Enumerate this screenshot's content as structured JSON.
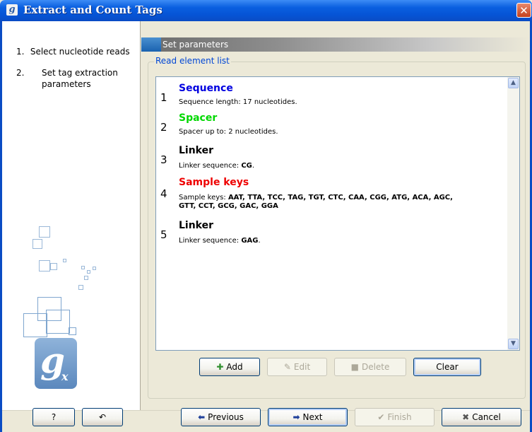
{
  "window": {
    "title": "Extract and Count Tags",
    "app_icon_letter": "g",
    "close_glyph": "✕"
  },
  "steps": [
    {
      "num": "1.",
      "label": "Select nucleotide reads"
    },
    {
      "num": "2.",
      "label": "Set tag extraction parameters"
    }
  ],
  "logo": {
    "g": "g",
    "x": "x"
  },
  "panel": {
    "header": "Set parameters",
    "group_label": "Read element list"
  },
  "elements": [
    {
      "num": "1",
      "name": "Sequence",
      "color": "#0000e0",
      "desc_prefix": "Sequence length: 17 nucleotides.",
      "desc_bold": "",
      "desc_suffix": ""
    },
    {
      "num": "2",
      "name": "Spacer",
      "color": "#00d800",
      "desc_prefix": "Spacer up to: 2 nucleotides.",
      "desc_bold": "",
      "desc_suffix": ""
    },
    {
      "num": "3",
      "name": "Linker",
      "color": "#000000",
      "desc_prefix": "Linker sequence: ",
      "desc_bold": "CG",
      "desc_suffix": "."
    },
    {
      "num": "4",
      "name": "Sample keys",
      "color": "#ee0000",
      "desc_prefix": "Sample keys: ",
      "desc_bold": "AAT, TTA, TCC, TAG, TGT, CTC, CAA, CGG, ATG, ACA, AGC, GTT, CCT, GCG, GAC, GGA",
      "desc_suffix": ""
    },
    {
      "num": "5",
      "name": "Linker",
      "color": "#000000",
      "desc_prefix": "Linker sequence: ",
      "desc_bold": "GAG",
      "desc_suffix": "."
    }
  ],
  "list_buttons": {
    "add": "Add",
    "edit": "Edit",
    "delete": "Delete",
    "clear": "Clear"
  },
  "footer": {
    "help": "?",
    "reset_glyph": "↶",
    "previous": "Previous",
    "next": "Next",
    "finish": "Finish",
    "cancel": "Cancel"
  }
}
